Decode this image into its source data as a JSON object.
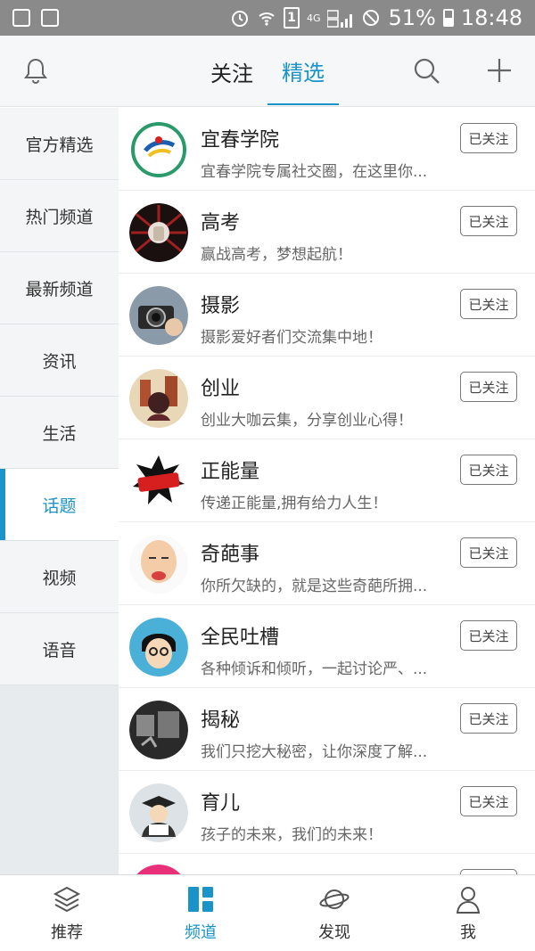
{
  "status_bar": {
    "network": "4G",
    "sim_badge": "1",
    "battery": "51%",
    "time": "18:48"
  },
  "header": {
    "tabs": [
      {
        "label": "关注"
      },
      {
        "label": "精选",
        "active": true
      }
    ],
    "icons": [
      "bell-icon",
      "search-icon",
      "plus-icon"
    ]
  },
  "sidebar": {
    "items": [
      {
        "label": "官方精选"
      },
      {
        "label": "热门频道"
      },
      {
        "label": "最新频道"
      },
      {
        "label": "资讯"
      },
      {
        "label": "生活"
      },
      {
        "label": "话题",
        "active": true
      },
      {
        "label": "视频"
      },
      {
        "label": "语音"
      }
    ]
  },
  "channels": [
    {
      "title": "宜春学院",
      "desc": "宜春学院专属社交圈，在这里你...",
      "button": "已关注",
      "color": "#2a9a6a"
    },
    {
      "title": "高考",
      "desc": "赢战高考，梦想起航！",
      "button": "已关注",
      "color": "#8b1a1a"
    },
    {
      "title": "摄影",
      "desc": "摄影爱好者们交流集中地！",
      "button": "已关注",
      "color": "#5a6a78"
    },
    {
      "title": "创业",
      "desc": "创业大咖云集，分享创业心得！",
      "button": "已关注",
      "color": "#c07840"
    },
    {
      "title": "正能量",
      "desc": "传递正能量,拥有给力人生！",
      "button": "已关注",
      "color": "#d62020"
    },
    {
      "title": "奇葩事",
      "desc": "你所欠缺的，就是这些奇葩所拥...",
      "button": "已关注",
      "color": "#f0c8a0"
    },
    {
      "title": "全民吐槽",
      "desc": "各种倾诉和倾听，一起讨论严、...",
      "button": "已关注",
      "color": "#4ab0d8"
    },
    {
      "title": "揭秘",
      "desc": "我们只挖大秘密，让你深度了解...",
      "button": "已关注",
      "color": "#3a3a3a"
    },
    {
      "title": "育儿",
      "desc": "孩子的未来，我们的未来！",
      "button": "已关注",
      "color": "#556070"
    }
  ],
  "bottom_nav": {
    "items": [
      {
        "label": "推荐",
        "icon": "layers-icon"
      },
      {
        "label": "频道",
        "icon": "channel-grid-icon",
        "active": true
      },
      {
        "label": "发现",
        "icon": "planet-icon"
      },
      {
        "label": "我",
        "icon": "person-icon"
      }
    ]
  },
  "colors": {
    "accent": "#1a93c8",
    "status_bar": "#8a8a8a",
    "sidebar_bg": "#e7ebee"
  }
}
